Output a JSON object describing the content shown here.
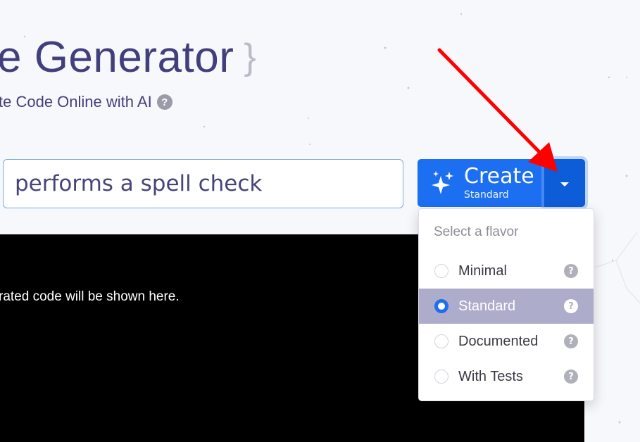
{
  "header": {
    "title": "e Generator",
    "title_brace": "}",
    "subtitle": "te Code Online with AI",
    "help_glyph": "?"
  },
  "prompt": {
    "value": "performs a spell check"
  },
  "create_button": {
    "label": "Create",
    "flavor": "Standard",
    "icon": "sparkle-icon"
  },
  "output": {
    "placeholder": "rated code will be shown here."
  },
  "flavor_menu": {
    "header": "Select a flavor",
    "options": [
      {
        "label": "Minimal",
        "selected": false
      },
      {
        "label": "Standard",
        "selected": true
      },
      {
        "label": "Documented",
        "selected": false
      },
      {
        "label": "With Tests",
        "selected": false
      }
    ],
    "help_glyph": "?"
  },
  "colors": {
    "primary": "#1d6ff2",
    "selected_row": "#aeaccb",
    "annotation_arrow": "#ff0000"
  }
}
